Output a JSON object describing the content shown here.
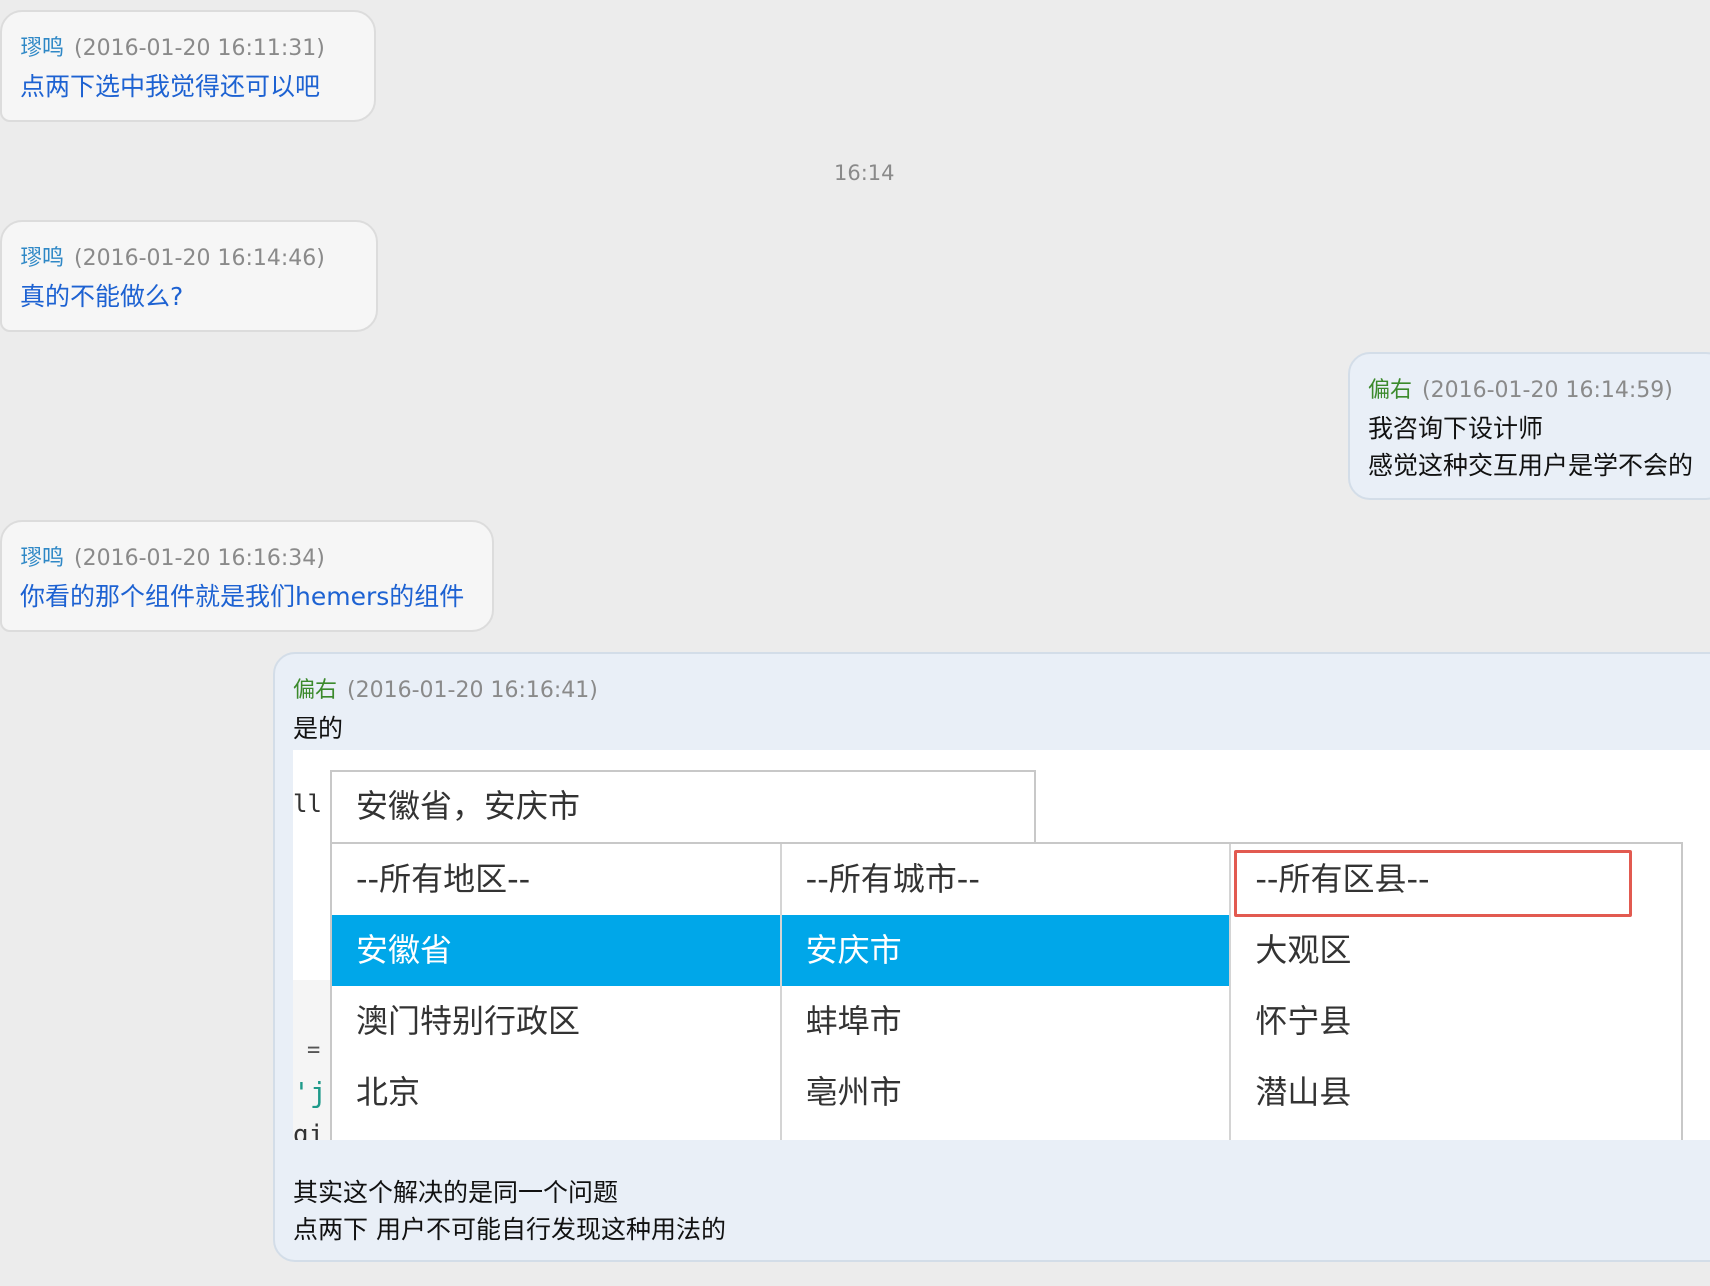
{
  "messages": [
    {
      "name": "璆鸣",
      "time": "(2016-01-20 16:11:31)",
      "lines": [
        "点两下选中我觉得还可以吧"
      ]
    },
    {
      "name": "璆鸣",
      "time": "(2016-01-20 16:14:46)",
      "lines": [
        "真的不能做么?"
      ]
    },
    {
      "name": "偏右",
      "time": "(2016-01-20 16:14:59)",
      "lines": [
        "我咨询下设计师",
        "感觉这种交互用户是学不会的"
      ]
    },
    {
      "name": "璆鸣",
      "time": "(2016-01-20 16:16:34)",
      "lines": [
        "你看的那个组件就是我们hemers的组件"
      ]
    },
    {
      "name": "偏右",
      "time": "(2016-01-20 16:16:41)",
      "lines": [
        "是的"
      ],
      "after_lines": [
        "其实这个解决的是同一个问题",
        "点两下 用户不可能自行发现这种用法的"
      ]
    }
  ],
  "divider_time": "16:14",
  "picker": {
    "input_value": "安徽省，安庆市",
    "columns": [
      {
        "options": [
          "--所有地区--",
          "安徽省",
          "澳门特别行政区",
          "北京"
        ],
        "selected": 1
      },
      {
        "options": [
          "--所有城市--",
          "安庆市",
          "蚌埠市",
          "亳州市"
        ],
        "selected": 1
      },
      {
        "options": [
          "--所有区县--",
          "大观区",
          "怀宁县",
          "潜山县"
        ],
        "selected": -1
      }
    ]
  },
  "code_fragments": {
    "a": "ll",
    "b": "=",
    "c": "'j",
    "d": "gi"
  },
  "colors": {
    "selected_bg": "#00a7e9",
    "highlight": "#e25a50",
    "name_left": "#2f88c6",
    "name_right": "#3b8a2c",
    "msg_left": "#1d62d2"
  }
}
